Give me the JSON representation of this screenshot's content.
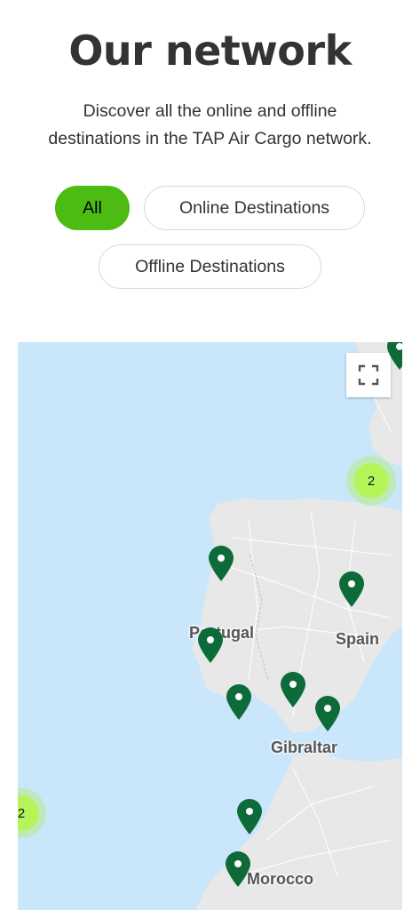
{
  "header": {
    "title": "Our network",
    "subtitle_line1": "Discover all the online and offline",
    "subtitle_line2": "destinations in the TAP Air Cargo network."
  },
  "filters": {
    "all": "All",
    "online": "Online Destinations",
    "offline": "Offline Destinations",
    "selected": "All"
  },
  "map": {
    "labels": {
      "portugal": "Portugal",
      "spain": "Spain",
      "gibraltar": "Gibraltar",
      "morocco": "Morocco"
    },
    "clusters": {
      "north_east_count": "2",
      "west_count": "2"
    },
    "pin_count": 9,
    "colors": {
      "water": "#c9e6fb",
      "land": "#e8e8e8",
      "pin": "#0d6b3a",
      "cluster": "#b6f55a",
      "active_filter": "#4cbc14"
    }
  }
}
